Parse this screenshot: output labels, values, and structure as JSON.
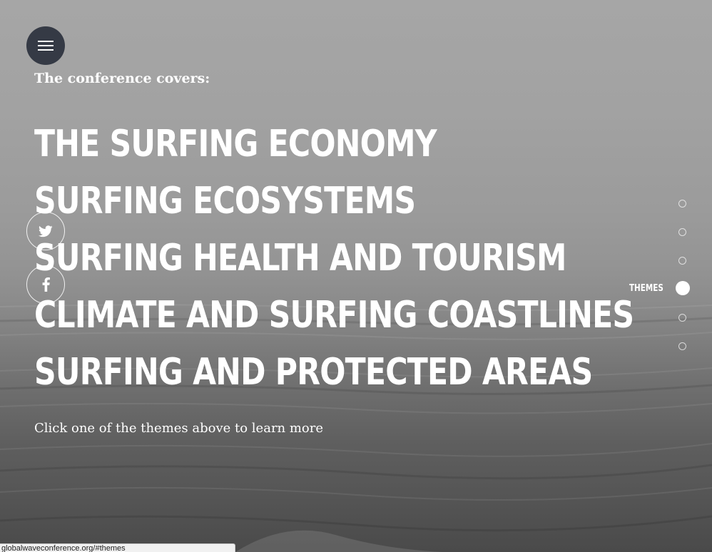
{
  "intro": "The conference covers:",
  "themes": [
    "The Surfing Economy",
    "Surfing Ecosystems",
    "Surfing Health and Tourism",
    "Climate and Surfing Coastlines",
    "Surfing and Protected Areas"
  ],
  "hint": "Click one of the themes above to learn more",
  "nav": {
    "active_label": "THEMES",
    "dot_count": 6,
    "active_index": 3
  },
  "icons": {
    "menu": "hamburger-menu-icon",
    "twitter": "twitter-icon",
    "facebook": "facebook-icon"
  },
  "colors": {
    "menu_button_bg": "#353a45",
    "text": "#ffffff"
  },
  "status_bar": {
    "url": "globalwaveconference.org/#themes"
  }
}
